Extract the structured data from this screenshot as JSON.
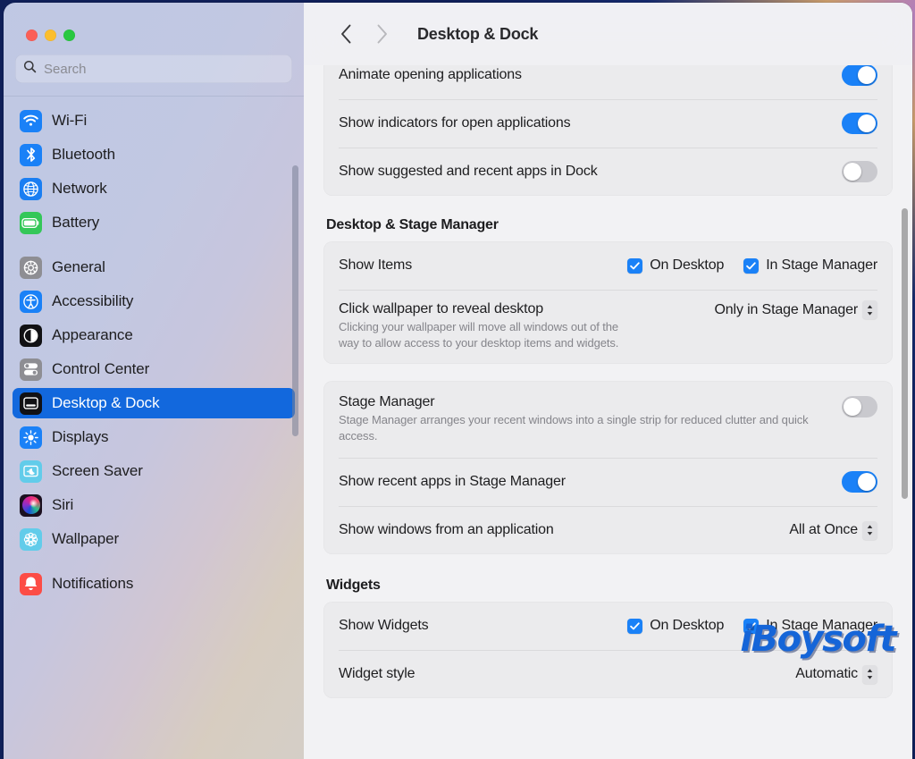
{
  "window": {
    "traffic_lights": [
      "close",
      "minimize",
      "zoom"
    ],
    "colors": {
      "accent_blue": "#1a81f7",
      "selection_blue": "#1268dd",
      "highlight_red": "#fc5b63",
      "watermark_blue": "#1565d8",
      "sidebar_bg": "#c7cee7",
      "content_bg": "#f2f2f4",
      "card_bg": "#ebebed"
    }
  },
  "search": {
    "placeholder": "Search",
    "value": "",
    "icon": "search-icon"
  },
  "sidebar": {
    "groups": [
      {
        "items": [
          {
            "label": "Wi-Fi",
            "icon": "wifi-icon",
            "selected": false
          },
          {
            "label": "Bluetooth",
            "icon": "bluetooth-icon",
            "selected": false
          },
          {
            "label": "Network",
            "icon": "globe-icon",
            "selected": false
          },
          {
            "label": "Battery",
            "icon": "battery-icon",
            "selected": false
          }
        ]
      },
      {
        "items": [
          {
            "label": "General",
            "icon": "gear-icon",
            "selected": false
          },
          {
            "label": "Accessibility",
            "icon": "accessibility-icon",
            "selected": false
          },
          {
            "label": "Appearance",
            "icon": "appearance-icon",
            "selected": false
          },
          {
            "label": "Control Center",
            "icon": "control-center-icon",
            "selected": false
          },
          {
            "label": "Desktop & Dock",
            "icon": "desktop-dock-icon",
            "selected": true
          },
          {
            "label": "Displays",
            "icon": "brightness-icon",
            "selected": false
          },
          {
            "label": "Screen Saver",
            "icon": "screen-saver-icon",
            "selected": false
          },
          {
            "label": "Siri",
            "icon": "siri-icon",
            "selected": false
          },
          {
            "label": "Wallpaper",
            "icon": "wallpaper-icon",
            "selected": false
          }
        ]
      },
      {
        "items": [
          {
            "label": "Notifications",
            "icon": "notifications-icon",
            "selected": false
          }
        ]
      }
    ]
  },
  "toolbar": {
    "back_label": "Back",
    "forward_label": "Forward",
    "title": "Desktop & Dock"
  },
  "main": {
    "dock_card": {
      "rows": [
        {
          "label": "Animate opening applications",
          "control": "toggle",
          "state": "on"
        },
        {
          "label": "Show indicators for open applications",
          "control": "toggle",
          "state": "on"
        },
        {
          "label": "Show suggested and recent apps in Dock",
          "control": "toggle",
          "state": "off"
        }
      ]
    },
    "desktop_stage_manager": {
      "title": "Desktop & Stage Manager",
      "show_items": {
        "label": "Show Items",
        "checkboxes": [
          {
            "label": "On Desktop",
            "checked": true
          },
          {
            "label": "In Stage Manager",
            "checked": true
          }
        ]
      },
      "click_wallpaper": {
        "label": "Click wallpaper to reveal desktop",
        "description": "Clicking your wallpaper will move all windows out of the way to allow access to your desktop items and widgets.",
        "value": "Only in Stage Manager"
      }
    },
    "stage_manager": {
      "label": "Stage Manager",
      "description": "Stage Manager arranges your recent windows into a single strip for reduced clutter and quick access.",
      "state": "off",
      "highlighted": true,
      "show_recent_apps": {
        "label": "Show recent apps in Stage Manager",
        "state": "on"
      },
      "show_windows": {
        "label": "Show windows from an application",
        "value": "All at Once"
      }
    },
    "widgets": {
      "title": "Widgets",
      "show_widgets": {
        "label": "Show Widgets",
        "checkboxes": [
          {
            "label": "On Desktop",
            "checked": true
          },
          {
            "label": "In Stage Manager",
            "checked": true
          }
        ]
      },
      "widget_style": {
        "label": "Widget style",
        "value": "Automatic"
      }
    }
  },
  "watermark": {
    "text": "iBoysoft"
  }
}
